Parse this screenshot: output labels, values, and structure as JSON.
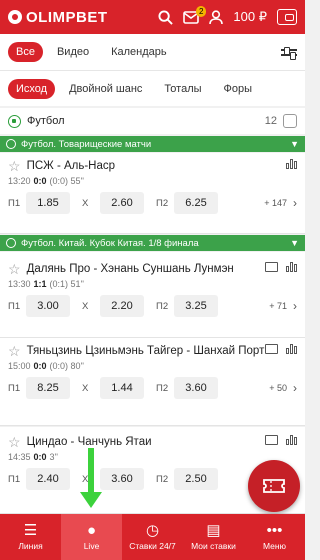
{
  "topbar": {
    "brand": "OLIMPBET",
    "notif_count": "2",
    "balance": "100 ₽"
  },
  "nav_tabs": [
    "Все",
    "Видео",
    "Календарь"
  ],
  "market_tabs": [
    "Исход",
    "Двойной шанс",
    "Тоталы",
    "Форы"
  ],
  "sport": {
    "name": "Футбол",
    "count": "12"
  },
  "leagues": [
    {
      "name": "Футбол. Товарищеские матчи"
    },
    {
      "name": "Футбол. Китай. Кубок Китая. 1/8 финала"
    }
  ],
  "matches": [
    {
      "teams": "ПСЖ - Аль-Наср",
      "time": "13:20",
      "score": "0:0",
      "detail": "(0:0) 55''",
      "odds": [
        "1.85",
        "2.60",
        "6.25"
      ],
      "more": "+ 147"
    },
    {
      "teams": "Далянь Про - Хэнань Суншань Лунмэн",
      "time": "13:30",
      "score": "1:1",
      "detail": "(0:1) 51''",
      "odds": [
        "3.00",
        "2.20",
        "3.25"
      ],
      "more": "+ 71"
    },
    {
      "teams": "Тяньцзинь Цзиньмэнь Тайгер - Шанхай Порт",
      "time": "15:00",
      "score": "0:0",
      "detail": "(0:0) 80''",
      "odds": [
        "8.25",
        "1.44",
        "3.60"
      ],
      "more": "+ 50"
    },
    {
      "teams": "Циндао - Чанчунь Ятаи",
      "time": "14:35",
      "score": "0:0",
      "detail": "3''",
      "odds": [
        "2.40",
        "3.60",
        "2.50"
      ],
      "more": ""
    }
  ],
  "odds_labels": [
    "П1",
    "X",
    "П2"
  ],
  "bottom_tabs": [
    "Линия",
    "Live",
    "Ставки 24/7",
    "Мои ставки",
    "Меню"
  ],
  "colors": {
    "brand": "#d8232a",
    "league": "#3ca24a"
  }
}
